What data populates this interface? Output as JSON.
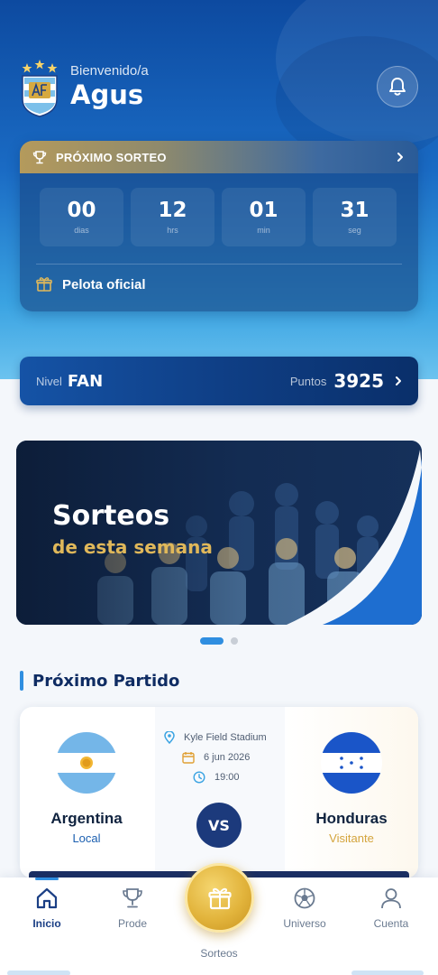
{
  "header": {
    "welcome": "Bienvenido/a",
    "username": "Agus"
  },
  "draw": {
    "title": "PRÓXIMO SORTEO",
    "countdown": [
      {
        "value": "00",
        "unit": "dias"
      },
      {
        "value": "12",
        "unit": "hrs"
      },
      {
        "value": "01",
        "unit": "min"
      },
      {
        "value": "31",
        "unit": "seg"
      }
    ],
    "prize": "Pelota oficial"
  },
  "level": {
    "nivel_label": "Nivel",
    "nivel_value": "FAN",
    "puntos_label": "Puntos",
    "puntos_value": "3925"
  },
  "banner": {
    "title": "Sorteos",
    "subtitle": "de esta semana",
    "slide_index": 1,
    "slide_count": 2
  },
  "match": {
    "section_title": "Próximo Partido",
    "home_team": "Argentina",
    "home_role": "Local",
    "away_team": "Honduras",
    "away_role": "Visitante",
    "stadium": "Kyle Field Stadium",
    "date": "6 jun 2026",
    "time": "19:00",
    "vs_label": "VS"
  },
  "tabbar": {
    "tabs": [
      {
        "label": "Inicio",
        "icon": "home-icon"
      },
      {
        "label": "Prode",
        "icon": "trophy-icon"
      },
      {
        "label": "Sorteos",
        "icon": "gift-icon"
      },
      {
        "label": "Universo",
        "icon": "soccer-ball-icon"
      },
      {
        "label": "Cuenta",
        "icon": "user-icon"
      }
    ],
    "active": "Inicio"
  },
  "colors": {
    "primary": "#1b3f85",
    "accent": "#2f8ee0",
    "gold": "#e0b85a",
    "visitante": "#d4a43c"
  }
}
